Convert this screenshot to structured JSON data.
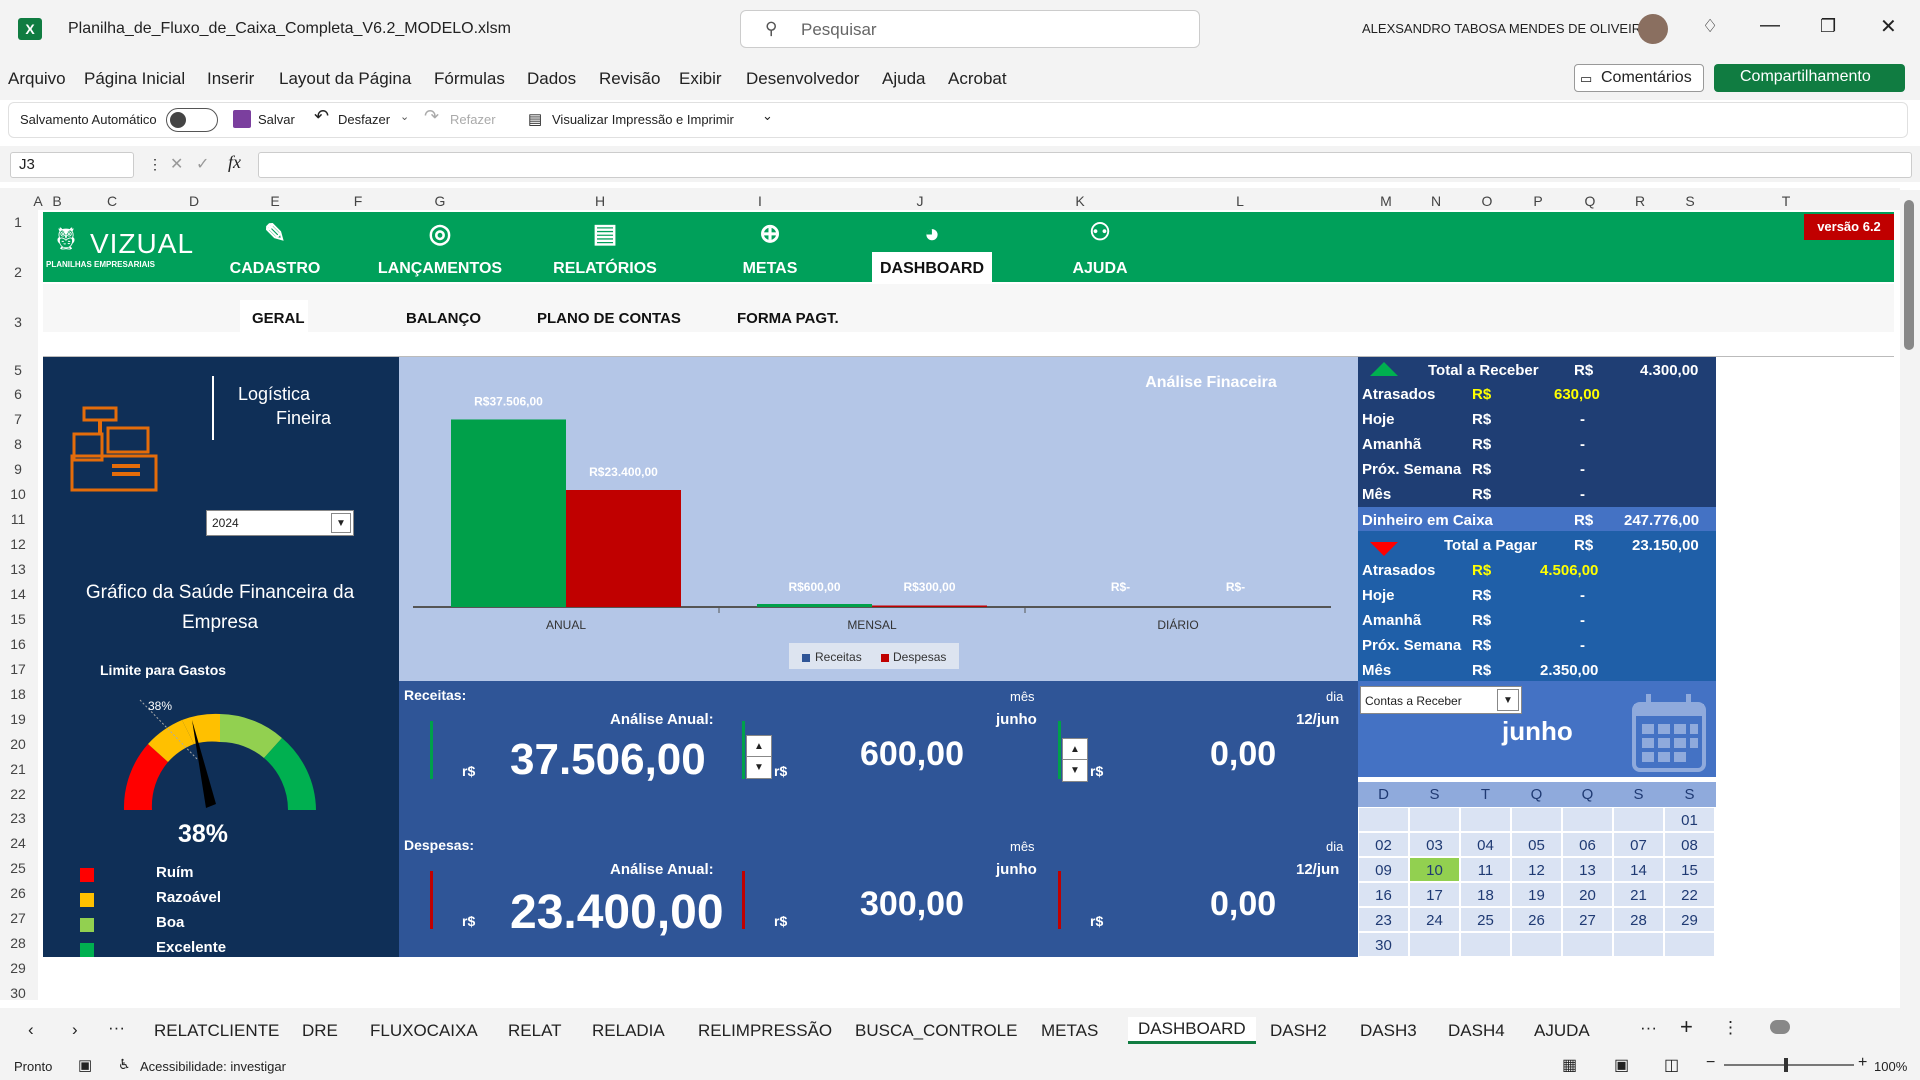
{
  "window": {
    "filename": "Planilha_de_Fluxo_de_Caixa_Completa_V6.2_MODELO.xlsm",
    "search_placeholder": "Pesquisar",
    "user": "ALEXSANDRO TABOSA MENDES DE OLIVEIRA"
  },
  "menu": [
    "Arquivo",
    "Página Inicial",
    "Inserir",
    "Layout da Página",
    "Fórmulas",
    "Dados",
    "Revisão",
    "Exibir",
    "Desenvolvedor",
    "Ajuda",
    "Acrobat"
  ],
  "buttons": {
    "comments": "Comentários",
    "share": "Compartilhamento"
  },
  "qat": {
    "autosave": "Salvamento Automático",
    "save": "Salvar",
    "undo": "Desfazer",
    "redo": "Refazer",
    "print": "Visualizar Impressão e Imprimir"
  },
  "formula": {
    "namebox": "J3",
    "fx": "fx"
  },
  "columns": [
    "A",
    "B",
    "C",
    "D",
    "E",
    "F",
    "G",
    "H",
    "I",
    "J",
    "K",
    "L",
    "M",
    "N",
    "O",
    "P",
    "Q",
    "R",
    "S",
    "T"
  ],
  "rows": [
    "1",
    "2",
    "3",
    "5",
    "6",
    "7",
    "8",
    "9",
    "10",
    "11",
    "12",
    "13",
    "14",
    "15",
    "16",
    "17",
    "18",
    "19",
    "20",
    "21",
    "22",
    "23",
    "24",
    "25",
    "26",
    "27",
    "28",
    "29",
    "30"
  ],
  "brand": {
    "name": "VIZUAL",
    "tag": "PLANILHAS EMPRESARIAIS",
    "version": "versão 6.2"
  },
  "nav": [
    "CADASTRO",
    "LANÇAMENTOS",
    "RELATÓRIOS",
    "METAS",
    "DASHBOARD",
    "AJUDA"
  ],
  "subtabs": [
    "GERAL",
    "BALANÇO",
    "PLANO DE CONTAS",
    "FORMA PAGT."
  ],
  "left": {
    "heading1": "Logística",
    "heading2": "Fineira",
    "year": "2024",
    "health_title": "Gráfico da Saúde Financeira da Empresa",
    "gauge_label": "Limite para Gastos",
    "gauge_pct": "38%",
    "gauge_value": 38,
    "legend": [
      "Ruím",
      "Razoável",
      "Boa",
      "Excelente"
    ]
  },
  "chart_data": {
    "type": "bar",
    "title": "Análise Finaceira",
    "categories": [
      "ANUAL",
      "MENSAL",
      "DIÁRIO"
    ],
    "series": [
      {
        "name": "Receitas",
        "values": [
          37506,
          600,
          0
        ],
        "labels": [
          "R$37.506,00",
          "R$600,00",
          "R$-"
        ]
      },
      {
        "name": "Despesas",
        "values": [
          23400,
          300,
          0
        ],
        "labels": [
          "R$23.400,00",
          "R$300,00",
          "R$-"
        ]
      }
    ],
    "ylim": [
      0,
      40000
    ],
    "colors": [
      "#00a04a",
      "#c00000"
    ]
  },
  "receitas": {
    "label": "Receitas:",
    "annual_label": "Análise Anual:",
    "month_hdr": "mês",
    "month": "junho",
    "day_hdr": "dia",
    "day": "12/jun",
    "cur": "r$",
    "annual": "37.506,00",
    "monthly": "600,00",
    "daily": "0,00"
  },
  "despesas": {
    "label": "Despesas:",
    "annual_label": "Análise Anual:",
    "month_hdr": "mês",
    "month": "junho",
    "day_hdr": "dia",
    "day": "12/jun",
    "cur": "r$",
    "annual": "23.400,00",
    "monthly": "300,00",
    "daily": "0,00"
  },
  "receber": {
    "title": "Total a Receber",
    "cur": "R$",
    "total": "4.300,00",
    "rows": [
      [
        "Atrasados",
        "R$",
        "630,00"
      ],
      [
        "Hoje",
        "R$",
        "-"
      ],
      [
        "Amanhã",
        "R$",
        "-"
      ],
      [
        "Próx. Semana",
        "R$",
        "-"
      ],
      [
        "Mês",
        "R$",
        "-"
      ]
    ]
  },
  "caixa": {
    "label": "Dinheiro em Caixa",
    "cur": "R$",
    "value": "247.776,00"
  },
  "pagar": {
    "title": "Total a Pagar",
    "cur": "R$",
    "total": "23.150,00",
    "rows": [
      [
        "Atrasados",
        "R$",
        "4.506,00"
      ],
      [
        "Hoje",
        "R$",
        "-"
      ],
      [
        "Amanhã",
        "R$",
        "-"
      ],
      [
        "Próx. Semana",
        "R$",
        "-"
      ],
      [
        "Mês",
        "R$",
        "2.350,00"
      ]
    ]
  },
  "calendar": {
    "select": "Contas a Receber",
    "month": "junho",
    "weekdays": [
      "D",
      "S",
      "T",
      "Q",
      "Q",
      "S",
      "S"
    ],
    "weeks": [
      [
        "",
        "",
        "",
        "",
        "",
        "",
        "01"
      ],
      [
        "02",
        "03",
        "04",
        "05",
        "06",
        "07",
        "08"
      ],
      [
        "09",
        "10",
        "11",
        "12",
        "13",
        "14",
        "15"
      ],
      [
        "16",
        "17",
        "18",
        "19",
        "20",
        "21",
        "22"
      ],
      [
        "23",
        "24",
        "25",
        "26",
        "27",
        "28",
        "29"
      ],
      [
        "30",
        "",
        "",
        "",
        "",
        "",
        ""
      ]
    ],
    "highlight": "10"
  },
  "sheets": [
    "RELATCLIENTE",
    "DRE",
    "FLUXOCAIXA",
    "RELAT",
    "RELADIA",
    "RELIMPRESSÃO",
    "BUSCA_CONTROLE",
    "METAS",
    "DASHBOARD",
    "DASH2",
    "DASH3",
    "DASH4",
    "AJUDA"
  ],
  "active_sheet": "DASHBOARD",
  "status": {
    "ready": "Pronto",
    "accessibility": "Acessibilidade: investigar",
    "zoom": "100%"
  }
}
